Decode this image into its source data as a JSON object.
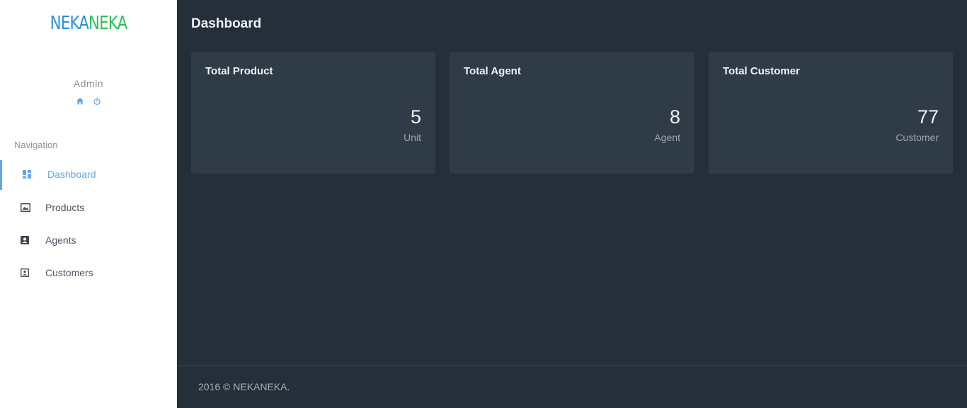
{
  "brand": {
    "part1": "NEKA",
    "part2": "NEKA"
  },
  "user": {
    "name": "Admin",
    "icons": [
      "home-icon",
      "power-icon"
    ]
  },
  "nav": {
    "title": "Navigation",
    "items": [
      {
        "label": "Dashboard",
        "icon": "dashboard-icon",
        "active": true
      },
      {
        "label": "Products",
        "icon": "products-icon",
        "active": false
      },
      {
        "label": "Agents",
        "icon": "agents-icon",
        "active": false
      },
      {
        "label": "Customers",
        "icon": "customers-icon",
        "active": false
      }
    ]
  },
  "page": {
    "title": "Dashboard"
  },
  "cards": [
    {
      "title": "Total Product",
      "value": "5",
      "unit": "Unit"
    },
    {
      "title": "Total Agent",
      "value": "8",
      "unit": "Agent"
    },
    {
      "title": "Total Customer",
      "value": "77",
      "unit": "Customer"
    }
  ],
  "footer": {
    "text": "2016 © NEKANEKA."
  },
  "colors": {
    "sidebar_bg": "#ffffff",
    "main_bg": "#242f3a",
    "card_bg": "#2f3c48",
    "accent": "#5fa8e8",
    "brand_blue": "#2d8fdd",
    "brand_green": "#2fbf5a"
  }
}
